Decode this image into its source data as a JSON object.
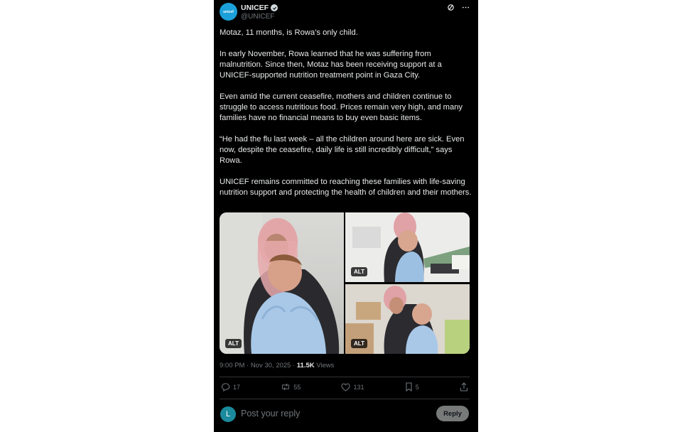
{
  "account": {
    "name": "UNICEF",
    "handle": "@UNICEF",
    "avatar_text": "unicef",
    "brand_color": "#1ca0d9"
  },
  "post": {
    "paragraphs": [
      "Motaz, 11 months, is Rowa’s only child.",
      "In early November, Rowa learned that he was suffering from malnutrition. Since then, Motaz has been receiving support at a UNICEF-supported nutrition treatment point in Gaza City.",
      "Even amid the current ceasefire, mothers and children continue to struggle to access nutritious food. Prices remain very high, and many families have no financial means to buy even basic items.",
      "“He had the flu last week – all the children around here are sick. Even now, despite the ceasefire, daily life is still incredibly difficult,” says Rowa.",
      "UNICEF remains committed to reaching these families with life-saving nutrition support and protecting the health of children and their mothers."
    ],
    "images": [
      {
        "alt_badge": "ALT"
      },
      {
        "alt_badge": "ALT"
      },
      {
        "alt_badge": "ALT"
      }
    ],
    "timestamp": "9:00 PM · Nov 30, 2025 ·",
    "views_count": "11.5K",
    "views_label": "Views"
  },
  "actions": {
    "replies": "17",
    "reposts": "55",
    "likes": "131",
    "bookmarks": "5"
  },
  "reply_box": {
    "avatar_letter": "L",
    "placeholder": "Post your reply",
    "button_label": "Reply"
  }
}
